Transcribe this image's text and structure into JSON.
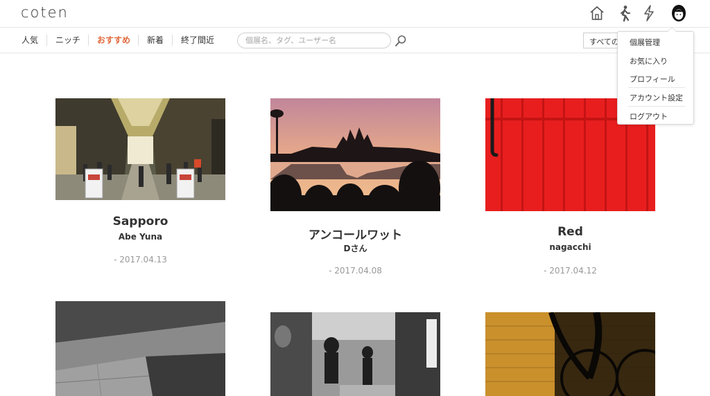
{
  "app": {
    "logo": "coten"
  },
  "header_icons": [
    "home-icon",
    "walking-person-icon",
    "lightning-icon",
    "user-avatar-icon"
  ],
  "nav": {
    "items": [
      {
        "label": "人気",
        "active": false
      },
      {
        "label": "ニッチ",
        "active": false
      },
      {
        "label": "おすすめ",
        "active": true
      },
      {
        "label": "新着",
        "active": false
      },
      {
        "label": "終了間近",
        "active": false
      }
    ],
    "accent_color": "#e0683a"
  },
  "search": {
    "placeholder": "個展名、タグ、ユーザー名"
  },
  "filter": {
    "selected": "すべての"
  },
  "user_menu": {
    "items": [
      {
        "label": "個展管理"
      },
      {
        "label": "お気に入り"
      },
      {
        "label": "プロフィール"
      },
      {
        "label": "アカウント設定"
      },
      {
        "label": "ログアウト"
      }
    ]
  },
  "exhibitions": [
    {
      "title": "Sapporo",
      "author": "Abe Yuna",
      "date": "- 2017.04.13",
      "image": "shopping-arcade-photo"
    },
    {
      "title": "アンコールワット",
      "author": "Dさん",
      "date": "- 2017.04.08",
      "image": "angkor-wat-sunset-photo"
    },
    {
      "title": "Red",
      "author": "nagacchi",
      "date": "- 2017.04.12",
      "image": "red-door-photo"
    },
    {
      "title": "",
      "author": "",
      "date": "",
      "image": "gray-architecture-photo"
    },
    {
      "title": "",
      "author": "",
      "date": "",
      "image": "street-children-photo"
    },
    {
      "title": "",
      "author": "",
      "date": "",
      "image": "bicycle-shadow-photo"
    }
  ]
}
